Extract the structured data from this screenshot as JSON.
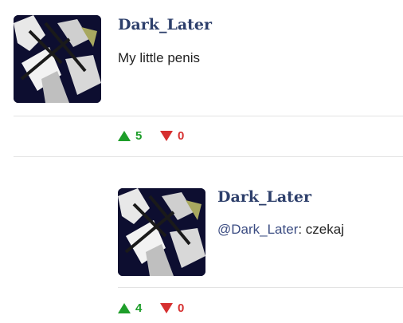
{
  "colors": {
    "username": "#2d3f6b",
    "upvote": "#1e9e2a",
    "downvote": "#d63030",
    "mention": "#3b4c82",
    "divider": "#e3e3e3"
  },
  "comments": [
    {
      "username": "Dark_Later",
      "text": "My little penis",
      "upvotes": "5",
      "downvotes": "0",
      "upvote_icon": "arrow-up-triangle-icon",
      "downvote_icon": "arrow-down-triangle-icon"
    },
    {
      "username": "Dark_Later",
      "mention": "@Dark_Later",
      "text": ": czekaj",
      "upvotes": "4",
      "downvotes": "0",
      "upvote_icon": "arrow-up-triangle-icon",
      "downvote_icon": "arrow-down-triangle-icon"
    }
  ]
}
